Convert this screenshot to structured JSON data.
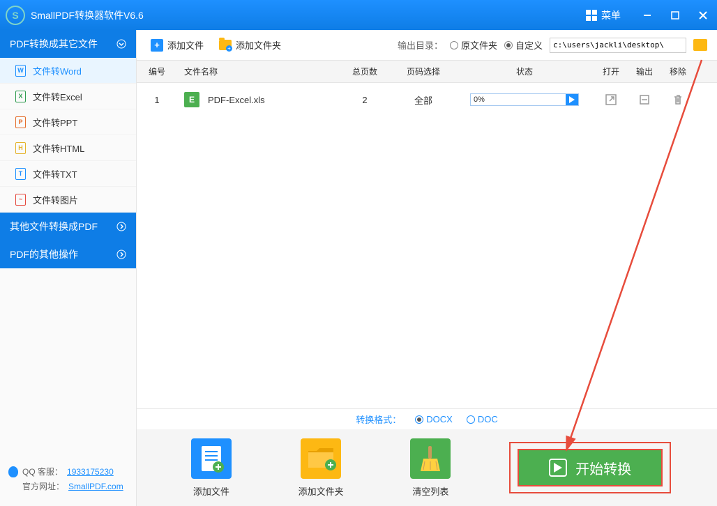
{
  "titlebar": {
    "title": "SmallPDF转换器软件V6.6",
    "menu": "菜单"
  },
  "sidebar": {
    "sections": [
      "PDF转换成其它文件",
      "其他文件转换成PDF",
      "PDF的其他操作"
    ],
    "items": [
      {
        "label": "文件转Word",
        "badge": "W"
      },
      {
        "label": "文件转Excel",
        "badge": "X"
      },
      {
        "label": "文件转PPT",
        "badge": "P"
      },
      {
        "label": "文件转HTML",
        "badge": "H"
      },
      {
        "label": "文件转TXT",
        "badge": "T"
      },
      {
        "label": "文件转图片",
        "badge": "~"
      }
    ]
  },
  "contact": {
    "qq_label": "QQ 客服：",
    "qq_number": "1933175230",
    "site_label": "官方网址：",
    "site_url": "SmallPDF.com"
  },
  "toolbar": {
    "add_file": "添加文件",
    "add_folder": "添加文件夹",
    "output_label": "输出目录：",
    "opt_same": "原文件夹",
    "opt_custom": "自定义",
    "path": "c:\\users\\jackli\\desktop\\"
  },
  "headers": {
    "num": "编号",
    "name": "文件名称",
    "pages": "总页数",
    "sel": "页码选择",
    "status": "状态",
    "open": "打开",
    "out": "输出",
    "del": "移除"
  },
  "rows": [
    {
      "num": "1",
      "badge": "E",
      "name": "PDF-Excel.xls",
      "pages": "2",
      "sel": "全部",
      "progress": "0%"
    }
  ],
  "format": {
    "label": "转换格式：",
    "docx": "DOCX",
    "doc": "DOC"
  },
  "actions": {
    "add_file": "添加文件",
    "add_folder": "添加文件夹",
    "clear": "清空列表",
    "start": "开始转换"
  }
}
